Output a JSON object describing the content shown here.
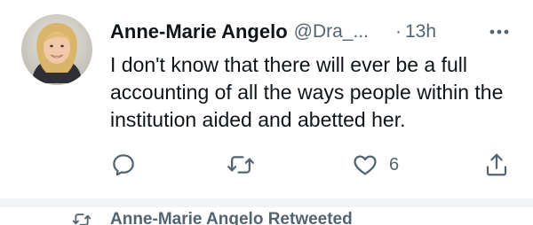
{
  "tweet": {
    "display_name": "Anne-Marie Angelo",
    "handle": "@Dra_...",
    "separator_dot": "·",
    "time": "13h",
    "text": "I don't know that there will ever be a full accounting of all the ways people within the institution aided and abetted her.",
    "like_count": "6"
  },
  "icons": {
    "more": "more-horizontal-icon",
    "reply": "reply-icon",
    "retweet": "retweet-icon",
    "like": "heart-icon",
    "share": "share-icon"
  },
  "next_tweet": {
    "context_label": "Anne-Marie Angelo Retweeted"
  },
  "colors": {
    "text_primary": "#0f1419",
    "text_secondary": "#536471",
    "separator": "#f1f3f4"
  }
}
